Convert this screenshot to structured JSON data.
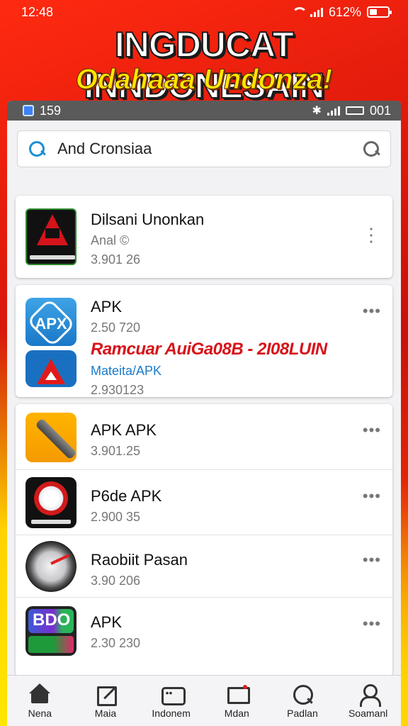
{
  "outer_status": {
    "time": "12:48",
    "battery": "612%"
  },
  "headline": "INGDUCAT INNDONESAIN",
  "subheadline": "Odahaaa Undonza!",
  "inner_status": {
    "left_text": "159",
    "right_text": "001"
  },
  "search": {
    "value": "And Cronsiaa"
  },
  "apps": [
    {
      "name": "Dilsani Unonkan",
      "sub": "Anal ©",
      "meta": "3.901 26",
      "icon": "dark-a-icon",
      "more": "⋮"
    },
    {
      "name": "APK",
      "sub": "2.50 720",
      "promo": "Ramcuar AuiGa08B - 2I08LUIN",
      "developer": "Mateita/APK",
      "meta": "2.930123",
      "icon": "apk-hex-icon",
      "icon2": "warning-triangle-icon",
      "more": "•••"
    },
    {
      "name": "APK APK",
      "meta": "3.901.25",
      "icon": "stick-icon",
      "more": "•••"
    },
    {
      "name": "P6de APK",
      "meta": "2.900 35",
      "icon": "circle-logo-icon",
      "more": "•••"
    },
    {
      "name": "Raobiit Pasan",
      "meta": "3.90 206",
      "icon": "gauge-icon",
      "more": "•••"
    },
    {
      "name": "APK",
      "meta": "2.30 230",
      "icon": "bdo-icon",
      "more": "•••"
    },
    {
      "name": "",
      "meta": "",
      "icon": "face-icon",
      "more": ""
    }
  ],
  "bottom_nav": [
    {
      "label": "Nena",
      "icon": "home-icon"
    },
    {
      "label": "Maia",
      "icon": "edit-icon"
    },
    {
      "label": "Indonem",
      "icon": "chat-icon"
    },
    {
      "label": "Mdan",
      "icon": "monitor-icon"
    },
    {
      "label": "Padlan",
      "icon": "search-icon"
    },
    {
      "label": "Soamanl",
      "icon": "user-icon"
    }
  ]
}
